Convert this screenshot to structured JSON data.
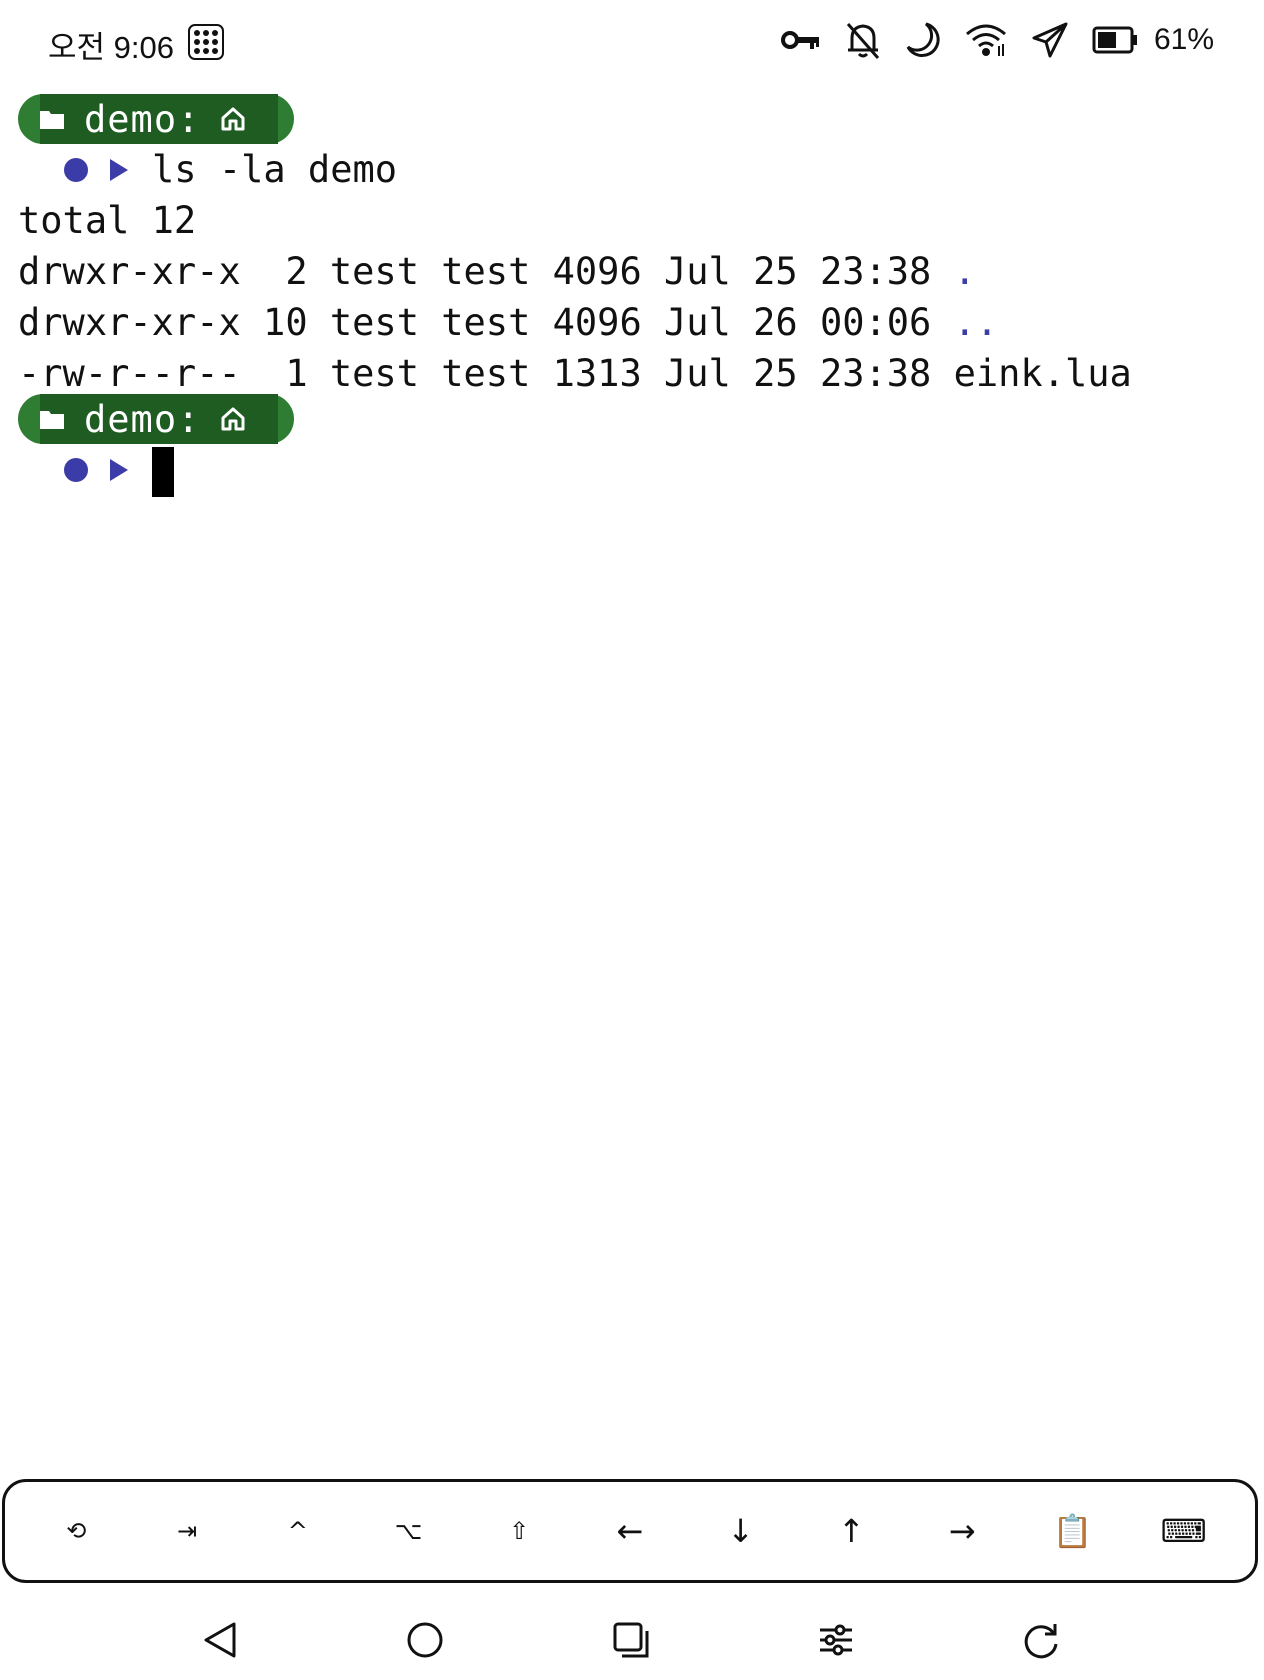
{
  "status_bar": {
    "time": "오전 9:06",
    "battery_percent": "61%",
    "icons": [
      "dots-grid-icon",
      "key-icon",
      "bell-off-icon",
      "moon-icon",
      "wifi-icon",
      "airplane-icon",
      "battery-icon"
    ]
  },
  "terminal": {
    "prompt_label": "demo:",
    "prompt_color": "#2e7d32",
    "accent_color": "#3b3ca8",
    "command": "ls -la demo",
    "output": [
      {
        "perms": "total 12",
        "rest": "",
        "name": ""
      },
      {
        "perms": "drwxr-xr-x",
        "rest": "  2 test test 4096 Jul 25 23:38 ",
        "name": "."
      },
      {
        "perms": "drwxr-xr-x",
        "rest": " 10 test test 4096 Jul 26 00:06 ",
        "name": ".."
      },
      {
        "perms": "-rw-r--r--",
        "rest": "  1 test test 1313 Jul 25 23:38 ",
        "name": "eink.lua"
      }
    ]
  },
  "extra_keys": [
    {
      "name": "history-icon",
      "label": "⟲"
    },
    {
      "name": "tab-key",
      "label": "⇥"
    },
    {
      "name": "ctrl-key",
      "label": "^"
    },
    {
      "name": "alt-key",
      "label": "⌥"
    },
    {
      "name": "shift-key",
      "label": "⇧"
    },
    {
      "name": "left-arrow-key",
      "label": "←"
    },
    {
      "name": "down-arrow-key",
      "label": "↓"
    },
    {
      "name": "up-arrow-key",
      "label": "↑"
    },
    {
      "name": "right-arrow-key",
      "label": "→"
    },
    {
      "name": "clipboard-icon",
      "label": "📋"
    },
    {
      "name": "keyboard-icon",
      "label": "⌨"
    }
  ],
  "nav_bar": [
    "back-icon",
    "home-icon",
    "recents-icon",
    "settings-icon",
    "refresh-icon"
  ]
}
